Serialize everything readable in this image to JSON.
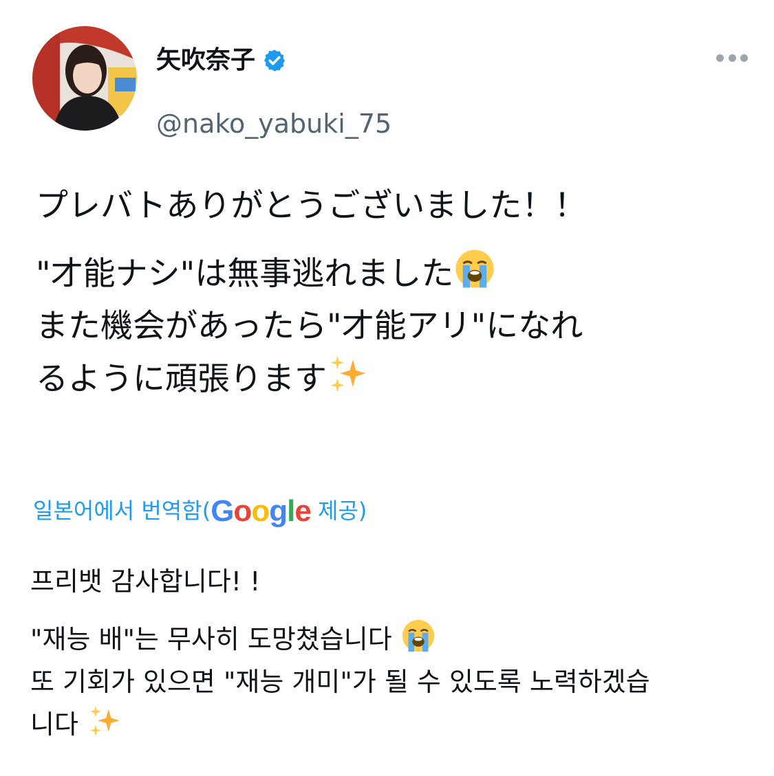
{
  "user": {
    "display_name": "矢吹奈子",
    "handle": "@nako_yabuki_75",
    "verified_icon": "verified-badge-icon",
    "accent_color": "#1d9bf0"
  },
  "menu": {
    "icon": "more-options-icon"
  },
  "tweet": {
    "line1": "プレバトありがとうございました！！",
    "line2": "\"才能ナシ\"は無事逃れました",
    "line3": "また機会があったら\"才能アリ\"になれ",
    "line4": "るように頑張ります"
  },
  "translation": {
    "prefix": "일본어에서 번역함(",
    "google_g1": "G",
    "google_o1": "o",
    "google_o2": "o",
    "google_g2": "g",
    "google_l": "l",
    "google_e": "e",
    "suffix": " 제공)"
  },
  "translated": {
    "line1": "프리뱃 감사합니다! !",
    "line2": " \"재능 배\"는 무사히 도망쳤습니다 ",
    "line3": " 또 기회가 있으면 \"재능 개미\"가 될 수 있도록 노력하겠습",
    "line4": "니다 "
  },
  "emojis": {
    "crying": "loudly-crying-face-icon",
    "sparkles": "sparkles-icon"
  }
}
